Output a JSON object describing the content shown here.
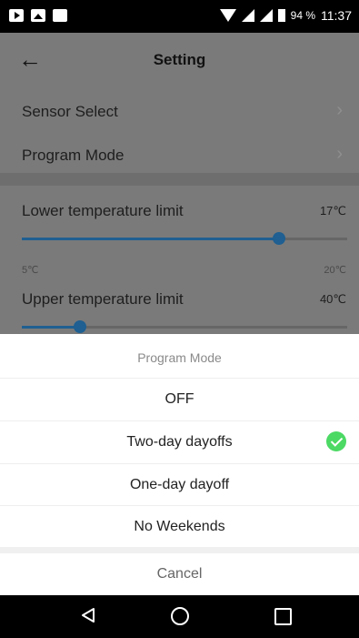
{
  "status_bar": {
    "battery_percent": "94 %",
    "time": "11:37"
  },
  "header": {
    "title": "Setting"
  },
  "menu": {
    "sensor_select": "Sensor Select",
    "program_mode": "Program Mode"
  },
  "lower_limit": {
    "label": "Lower temperature limit",
    "value": "17℃",
    "fraction": 0.79
  },
  "range": {
    "min": "5℃",
    "max": "20℃"
  },
  "upper_limit": {
    "label": "Upper temperature limit",
    "value": "40℃",
    "fraction": 0.18
  },
  "sheet": {
    "title": "Program Mode",
    "options": [
      "OFF",
      "Two-day dayoffs",
      "One-day dayoff",
      "No Weekends"
    ],
    "selected_index": 1,
    "cancel": "Cancel"
  },
  "colors": {
    "accent": "#1f5f91",
    "check": "#4cd964"
  }
}
